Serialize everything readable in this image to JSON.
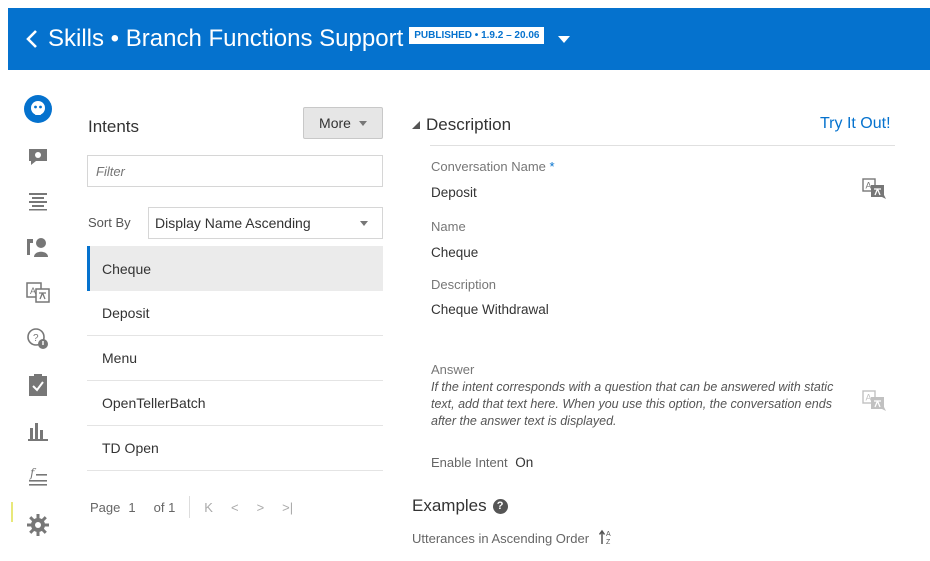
{
  "header": {
    "title": "Skills • Branch Functions Support",
    "badge": "PUBLISHED • 1.9.2 – 20.06",
    "accent_color": "#0572ce"
  },
  "rail": {
    "items": [
      {
        "icon": "bot-icon",
        "active": true
      },
      {
        "icon": "chat-gear-icon"
      },
      {
        "icon": "entities-icon"
      },
      {
        "icon": "components-icon"
      },
      {
        "icon": "resource-bundle-icon"
      },
      {
        "icon": "quality-icon"
      },
      {
        "icon": "checklist-icon"
      },
      {
        "icon": "insights-chart-icon"
      },
      {
        "icon": "function-icon"
      },
      {
        "icon": "settings-gear-icon"
      }
    ]
  },
  "intents": {
    "title": "Intents",
    "more_label": "More",
    "filter_placeholder": "Filter",
    "sort_label": "Sort By",
    "sort_value": "Display Name Ascending",
    "items": [
      "Cheque",
      "Deposit",
      "Menu",
      "OpenTellerBatch",
      "TD Open"
    ],
    "selected": "Cheque",
    "pager": {
      "page_label": "Page",
      "page": "1",
      "of_label": "of 1"
    }
  },
  "detail": {
    "section_title": "Description",
    "try_it_out": "Try It Out!",
    "conversation_name_label": "Conversation Name",
    "required_mark": "*",
    "conversation_name": "Deposit",
    "name_label": "Name",
    "name": "Cheque",
    "description_label": "Description",
    "description": "Cheque Withdrawal",
    "answer_label": "Answer",
    "answer_help": "If the intent corresponds with a question that can be answered with static text, add that text here. When you use this option, the conversation ends after the answer text is displayed.",
    "enable_label": "Enable Intent",
    "enable_value": "On",
    "examples_title": "Examples",
    "utterance_order": "Utterances in Ascending Order"
  }
}
